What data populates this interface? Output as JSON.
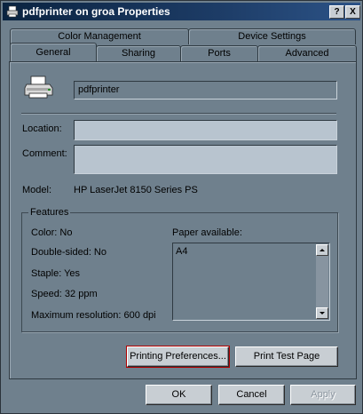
{
  "window": {
    "title": "pdfprinter on groa Properties"
  },
  "titlebar": {
    "help_label": "?",
    "close_label": "X"
  },
  "tabs": {
    "row_back": [
      {
        "label": "Color Management"
      },
      {
        "label": "Device Settings"
      }
    ],
    "row_front": [
      {
        "label": "General"
      },
      {
        "label": "Sharing"
      },
      {
        "label": "Ports"
      },
      {
        "label": "Advanced"
      }
    ],
    "active": "General"
  },
  "general": {
    "printer_name": "pdfprinter",
    "location_label": "Location:",
    "location_value": "",
    "comment_label": "Comment:",
    "comment_value": "",
    "model_label": "Model:",
    "model_value": "HP LaserJet 8150 Series PS"
  },
  "features": {
    "title": "Features",
    "color": "Color: No",
    "double_sided": "Double-sided: No",
    "staple": "Staple: Yes",
    "speed": "Speed: 32 ppm",
    "max_resolution": "Maximum resolution: 600 dpi",
    "paper_label": "Paper available:",
    "paper_items": [
      "A4"
    ]
  },
  "buttons": {
    "printing_preferences": "Printing Preferences...",
    "print_test_page": "Print Test Page",
    "ok": "OK",
    "cancel": "Cancel",
    "apply": "Apply"
  },
  "colors": {
    "dialog_bg": "#6f808d",
    "titlebar": "#1d3c66",
    "field_bg": "#b8c4cf",
    "focus_outline": "#b00000"
  }
}
